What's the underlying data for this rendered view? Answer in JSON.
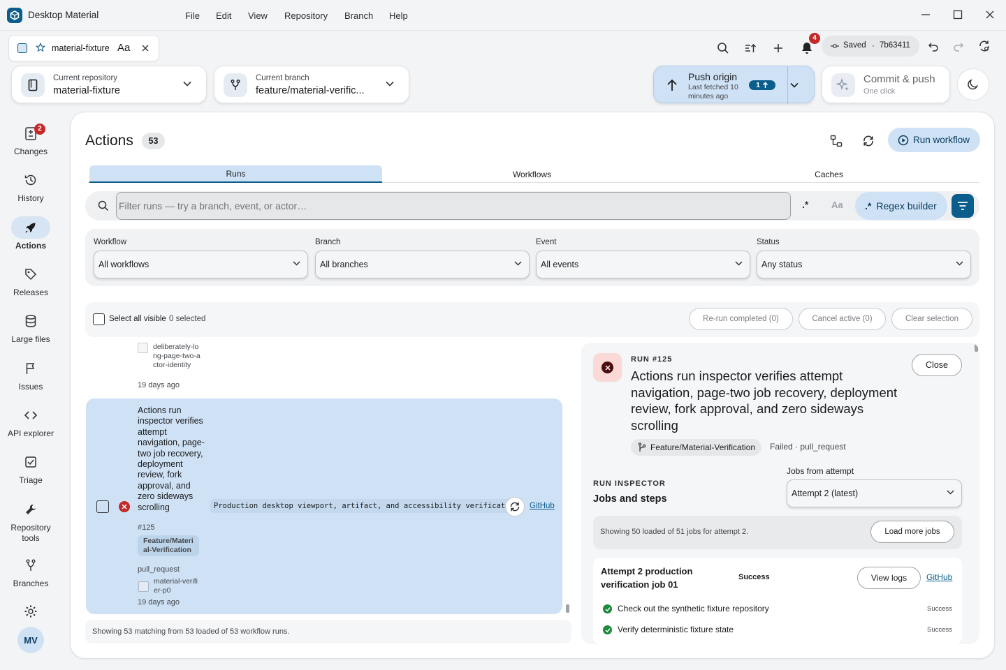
{
  "app": {
    "title": "Desktop Material"
  },
  "menu": [
    "File",
    "Edit",
    "View",
    "Repository",
    "Branch",
    "Help"
  ],
  "tab": {
    "name": "material-fixture",
    "font_toggle": "Aa"
  },
  "toolbar": {
    "notifications_count": "4",
    "saved_label": "Saved",
    "commit_sha": "7b63411"
  },
  "repo": {
    "label": "Current repository",
    "value": "material-fixture"
  },
  "branch": {
    "label": "Current branch",
    "value": "feature/material-verific..."
  },
  "push": {
    "title": "Push origin",
    "subtitle": "Last fetched 10 minutes ago",
    "ahead": "1"
  },
  "commit_push": {
    "title": "Commit & push",
    "subtitle": "One click"
  },
  "sidebar": {
    "items": [
      {
        "label": "Changes",
        "badge": "2"
      },
      {
        "label": "History"
      },
      {
        "label": "Actions"
      },
      {
        "label": "Releases"
      },
      {
        "label": "Large files"
      },
      {
        "label": "Issues"
      },
      {
        "label": "API explorer"
      },
      {
        "label": "Triage"
      },
      {
        "label": "Repository tools"
      },
      {
        "label": "Branches"
      }
    ],
    "avatar": "MV"
  },
  "actions": {
    "title": "Actions",
    "count": "53",
    "run_workflow": "Run workflow",
    "tabs": [
      "Runs",
      "Workflows",
      "Caches"
    ],
    "filter_placeholder": "Filter runs — try a branch, event, or actor…",
    "regex_toggle": ".*",
    "case_toggle": "Aa",
    "regex_builder": "Regex builder",
    "filters": [
      {
        "label": "Workflow",
        "value": "All workflows"
      },
      {
        "label": "Branch",
        "value": "All branches"
      },
      {
        "label": "Event",
        "value": "All events"
      },
      {
        "label": "Status",
        "value": "Any status"
      }
    ],
    "select_all": "Select all visible",
    "selected_count": "0 selected",
    "rerun": "Re-run completed (0)",
    "cancel_active": "Cancel active (0)",
    "clear_selection": "Clear selection",
    "footer": "Showing 53 matching from 53 loaded of 53 workflow runs."
  },
  "runs": {
    "prev_actor": "deliberately-long-page-two-actor-identity",
    "prev_time": "19 days ago",
    "selected": {
      "title": "Actions run inspector verifies attempt navigation, page-two job recovery, deployment review, fork approval, and zero sideways scrolling",
      "number": "#125",
      "branch": "Feature/Material-Verification",
      "event": "pull_request",
      "actor": "material-verifier-p0",
      "time": "19 days ago",
      "workflow": "Production desktop viewport, artifact, and accessibility verification",
      "github": "GitHub"
    }
  },
  "inspector": {
    "run_label": "RUN #125",
    "title": "Actions run inspector verifies attempt navigation, page-two job recovery, deployment review, fork approval, and zero sideways scrolling",
    "branch": "Feature/Material-Verification",
    "status_event": "Failed · pull_request",
    "close": "Close",
    "section_label": "RUN INSPECTOR",
    "section_title": "Jobs and steps",
    "attempt_label": "Jobs from attempt",
    "attempt_value": "Attempt 2 (latest)",
    "jobs_info": "Showing 50 loaded of 51 jobs for attempt 2.",
    "load_more": "Load more jobs",
    "job": {
      "name": "Attempt 2 production verification job 01",
      "status": "Success",
      "view_logs": "View logs",
      "github": "GitHub",
      "steps": [
        {
          "name": "Check out the synthetic fixture repository",
          "status": "Success"
        },
        {
          "name": "Verify deterministic fixture state",
          "status": "Success"
        }
      ]
    }
  },
  "colors": {
    "accent": "#0b5d8c",
    "accent_light": "#d6e4f3",
    "error": "#c62828",
    "success": "#1b8a3a"
  }
}
